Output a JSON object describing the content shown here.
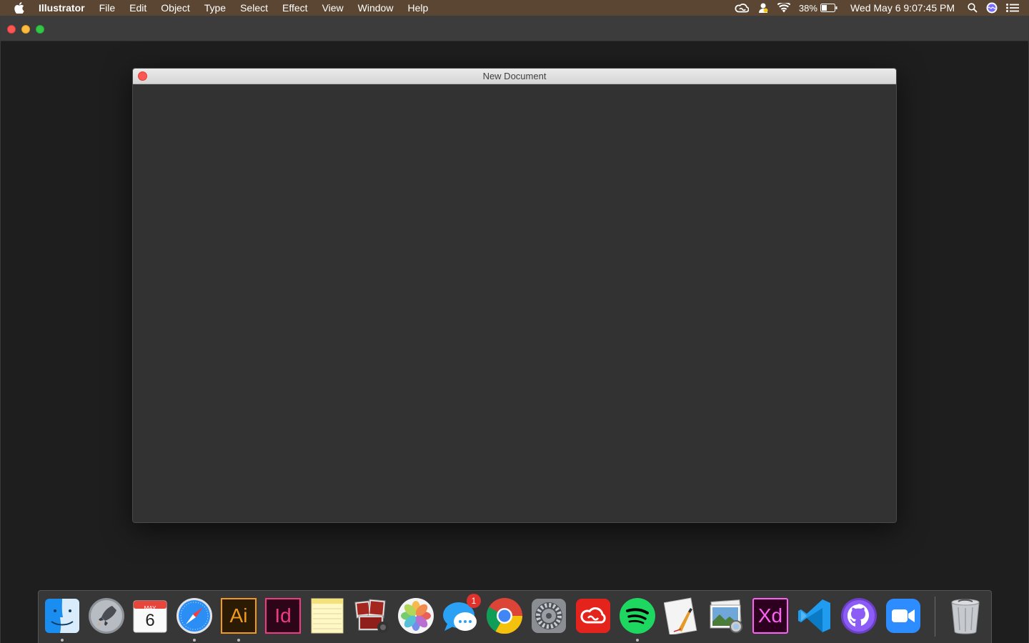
{
  "menubar": {
    "app_name": "Illustrator",
    "items": [
      {
        "label": "File"
      },
      {
        "label": "Edit"
      },
      {
        "label": "Object"
      },
      {
        "label": "Type"
      },
      {
        "label": "Select"
      },
      {
        "label": "Effect"
      },
      {
        "label": "View"
      },
      {
        "label": "Window"
      },
      {
        "label": "Help"
      }
    ],
    "battery_percent": "38%",
    "clock": "Wed May 6  9:07:45 PM"
  },
  "dialog": {
    "title": "New Document"
  },
  "dock": {
    "calendar_month": "MAY",
    "calendar_day": "6",
    "illustrator_label": "Ai",
    "indesign_label": "Id",
    "xd_label": "Xd",
    "messages_badge": "1"
  },
  "colors": {
    "menubar_bg": "#5a4632",
    "dialog_bg": "#323232",
    "desktop_bg": "#1e1e1e"
  }
}
